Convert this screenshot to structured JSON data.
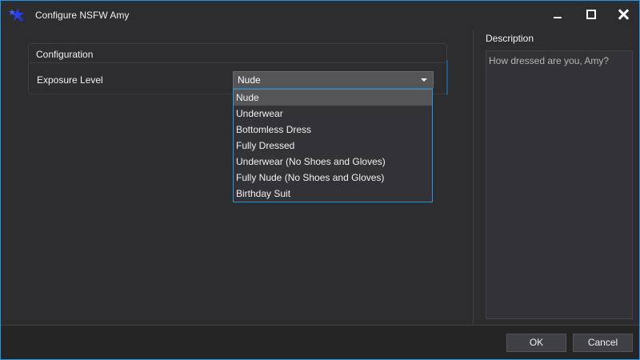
{
  "window": {
    "title": "Configure NSFW Amy",
    "app_icon": "stars-icon"
  },
  "colors": {
    "background": "#2d2d30",
    "accent": "#1c97ea",
    "footer": "#252526",
    "text": "#f1f1f1",
    "muted_text": "#b4b4b4"
  },
  "configuration": {
    "group_title": "Configuration",
    "exposure_label": "Exposure Level",
    "selected_value": "Nude",
    "options": [
      "Nude",
      "Underwear",
      "Bottomless Dress",
      "Fully Dressed",
      "Underwear (No Shoes and Gloves)",
      "Fully Nude (No Shoes and Gloves)",
      "Birthday Suit"
    ]
  },
  "description": {
    "label": "Description",
    "text": "How dressed are you, Amy?"
  },
  "footer": {
    "ok_label": "OK",
    "cancel_label": "Cancel"
  }
}
